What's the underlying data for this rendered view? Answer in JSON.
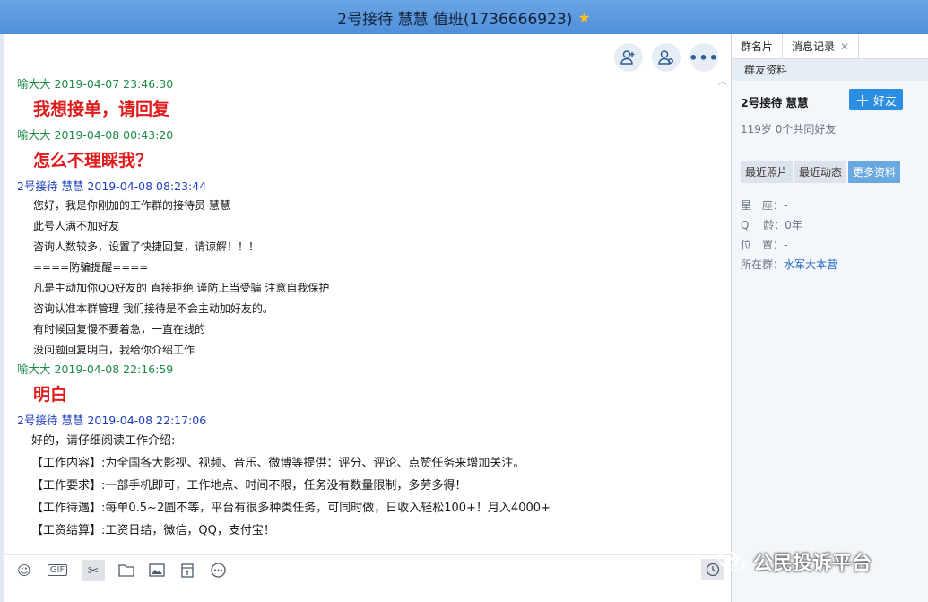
{
  "window": {
    "title": "2号接待 慧慧 值班(1736666923)"
  },
  "chat": {
    "messages": [
      {
        "sender": "喻大大",
        "time": "2019-04-07 23:46:30",
        "lines": [
          "我想接单，请回复"
        ]
      },
      {
        "sender": "喻大大",
        "time": "2019-04-08 00:43:20",
        "lines": [
          "怎么不理睬我？"
        ]
      },
      {
        "sender": "2号接待 慧慧",
        "time": "2019-04-08 08:23:44",
        "lines": [
          "您好，我是你刚加的工作群的接待员 慧慧",
          "此号人满不加好友",
          "咨询人数较多，设置了快捷回复，请谅解！！！",
          "====防骗提醒====",
          "凡是主动加你QQ好友的 直接拒绝  谨防上当受骗 注意自我保护",
          "咨询认准本群管理 我们接待是不会主动加好友的。",
          "有时候回复慢不要着急，一直在线的",
          "没问题回复明白，我给你介绍工作"
        ]
      },
      {
        "sender": "喻大大",
        "time": "2019-04-08 22:16:59",
        "lines": [
          "明白"
        ]
      },
      {
        "sender": "2号接待 慧慧",
        "time": "2019-04-08 22:17:06",
        "lines": [
          "好的，请仔细阅读工作介绍:",
          "【工作内容】:为全国各大影视、视频、音乐、微博等提供：评分、评论、点赞任务来增加关注。",
          "【工作要求】:一部手机即可，工作地点、时间不限，任务没有数量限制，多劳多得！",
          "【工作待遇】:每单0.5~2圆不等，平台有很多种类任务，可同时做，日收入轻松100+！月入4000+",
          "【工资结算】:工资日结，微信，QQ，支付宝！"
        ]
      }
    ]
  },
  "toolbar": {
    "gif_label": "GIF"
  },
  "side": {
    "tabs": [
      "群名片",
      "消息记录"
    ],
    "subtab": "群友资料",
    "profile_name": "2号接待 慧慧",
    "profile_sub": "119岁 0个共同好友",
    "add_friend": "好友",
    "info_tabs": [
      "最近照片",
      "最近动态",
      "更多资料"
    ],
    "info": {
      "xingzuo": "星　座：-",
      "qling": "Q　 龄：0年",
      "weizhi": "位　置：-",
      "group_label": "所在群：",
      "group_name": "水军大本营"
    }
  },
  "watermark": {
    "text": "公民投诉平台"
  },
  "colors": {
    "titlebar": "#5a98de",
    "red": "#e01b1b",
    "green": "#1e8a46",
    "blue": "#1f3fbd",
    "accent": "#2c8ee0"
  }
}
